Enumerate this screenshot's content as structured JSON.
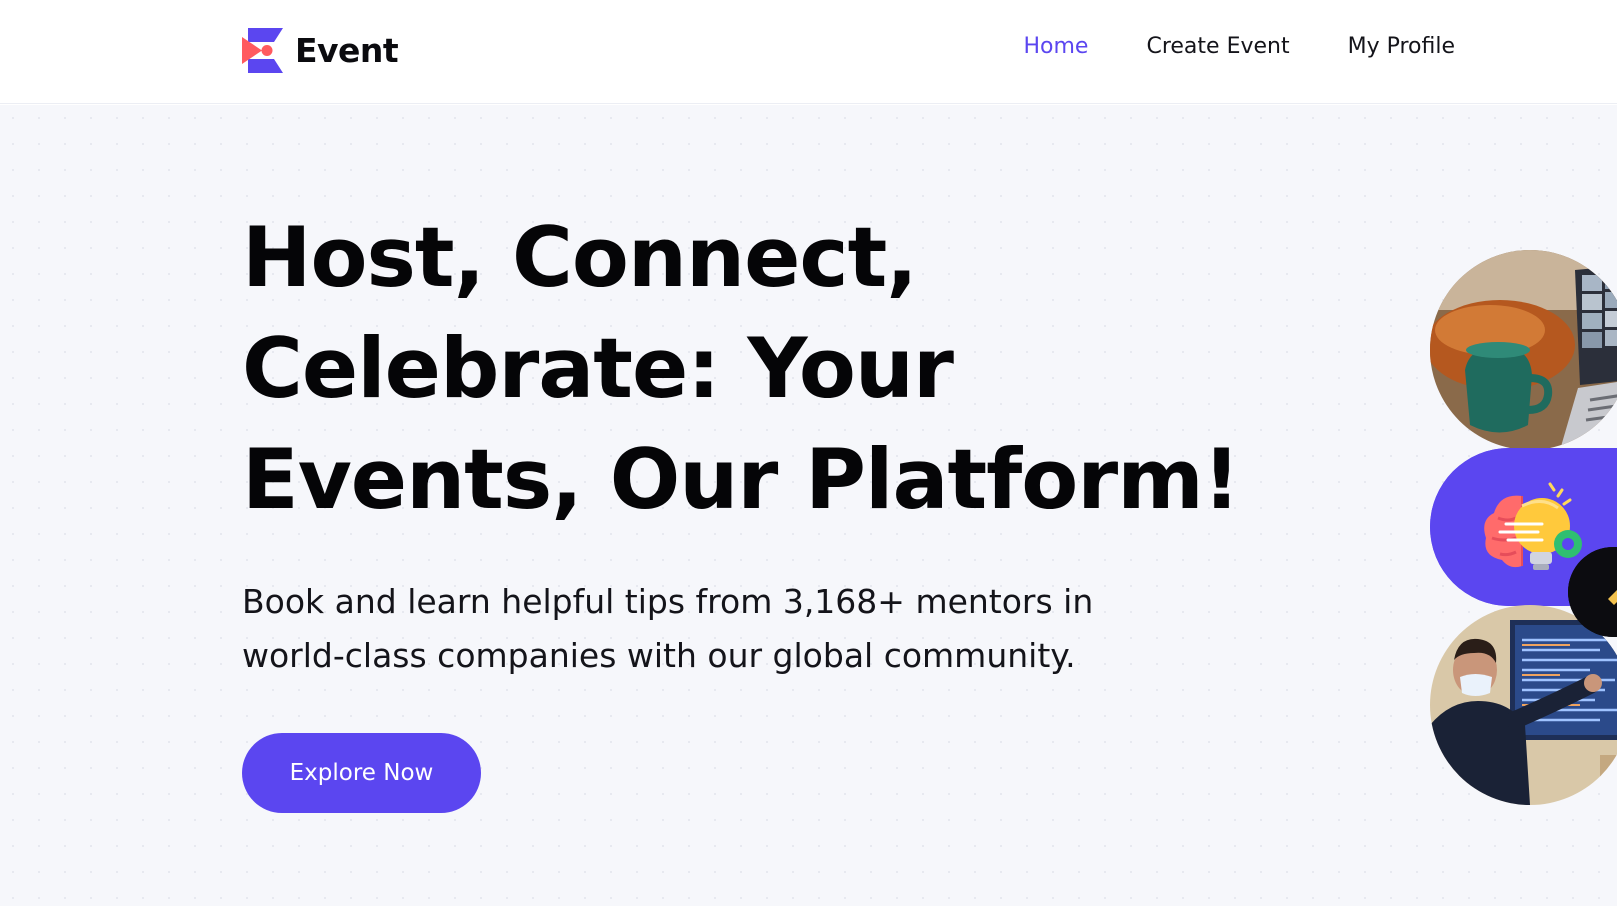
{
  "header": {
    "brand": "Event",
    "nav": [
      {
        "label": "Home",
        "active": true
      },
      {
        "label": "Create Event",
        "active": false
      },
      {
        "label": "My Profile",
        "active": false
      }
    ]
  },
  "hero": {
    "headline": "Host, Connect, Celebrate: Your Events, Our Platform!",
    "subtitle": "Book and learn helpful tips from 3,168+ mentors in world-class companies with our global community.",
    "cta_label": "Explore Now"
  },
  "colors": {
    "accent": "#5b46f0",
    "logo_red": "#ff5a5f",
    "hero_bg": "#f6f7fb",
    "text": "#050507"
  },
  "icons": {
    "logo": "event-logo-icon",
    "brain_bulb": "brain-lightbulb-icon"
  }
}
